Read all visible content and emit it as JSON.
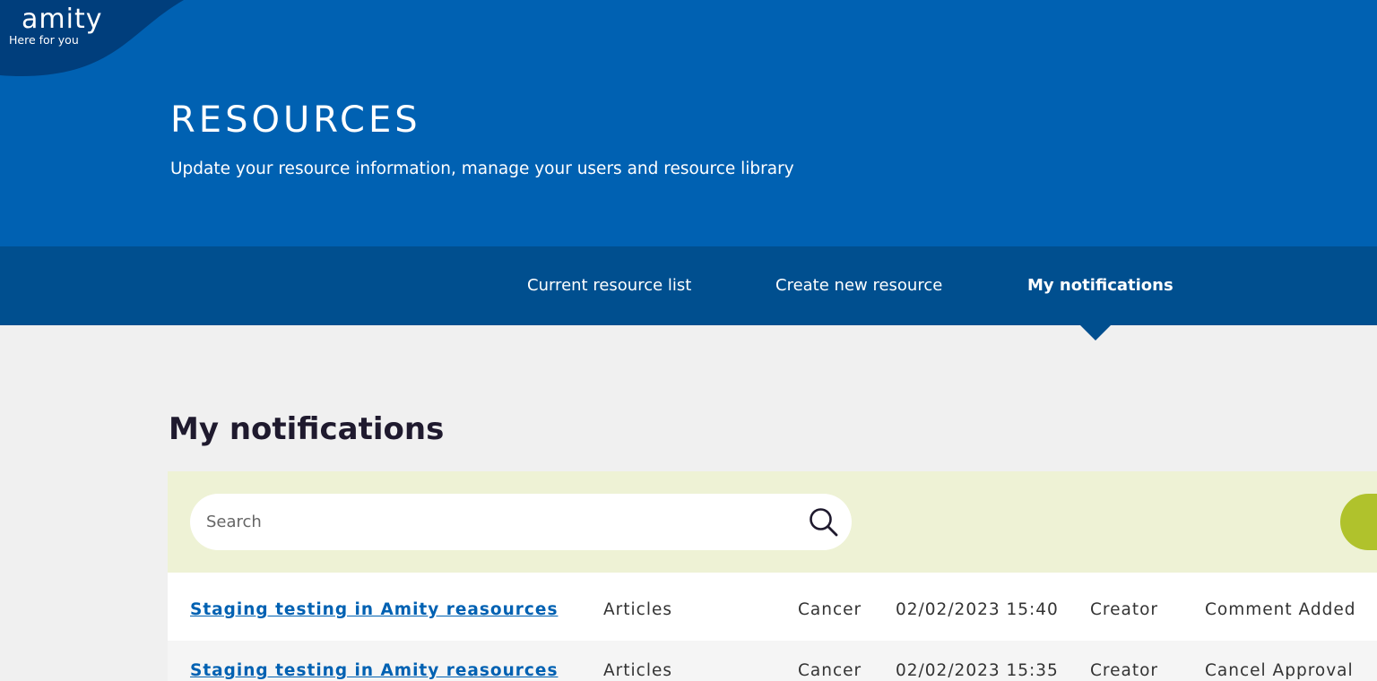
{
  "logo": {
    "name": "amity",
    "tagline": "Here for you"
  },
  "hero": {
    "title": "RESOURCES",
    "subtitle": "Update your resource information, manage your users and resource library"
  },
  "nav": {
    "tabs": [
      {
        "label": "Current resource list",
        "active": false
      },
      {
        "label": "Create new resource",
        "active": false
      },
      {
        "label": "My notifications",
        "active": true
      }
    ]
  },
  "main": {
    "section_title": "My notifications",
    "search": {
      "placeholder": "Search",
      "value": "",
      "icon": "search-icon"
    },
    "filter_button_icon": "filter-icon",
    "notifications": [
      {
        "title": "Staging testing in Amity reasources",
        "category": "Articles",
        "topic": "Cancer",
        "datetime": "02/02/2023 15:40",
        "role": "Creator",
        "action": "Comment Added"
      },
      {
        "title": "Staging testing in Amity reasources",
        "category": "Articles",
        "topic": "Cancer",
        "datetime": "02/02/2023 15:35",
        "role": "Creator",
        "action": "Cancel Approval"
      }
    ]
  },
  "colors": {
    "hero_blue": "#0061b2",
    "nav_blue": "#004f8f",
    "logo_blob": "#003e7c",
    "search_panel": "#eef2d5",
    "accent_green": "#b0c22c",
    "link_blue": "#0061b2"
  }
}
